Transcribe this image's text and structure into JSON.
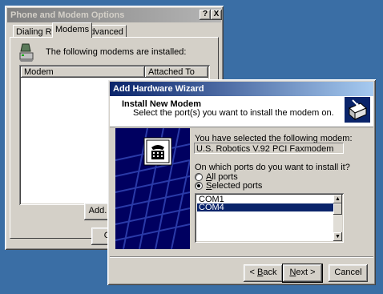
{
  "back_window": {
    "title": "Phone and Modem Options",
    "title_buttons": {
      "help": "?",
      "close": "X"
    },
    "tabs": [
      {
        "label": "Dialing Rules",
        "selected": false
      },
      {
        "label": "Modems",
        "selected": true
      },
      {
        "label": "Advanced",
        "selected": false
      }
    ],
    "installed_text": "The following modems are installed:",
    "columns": [
      "Modem",
      "Attached To"
    ],
    "add_button_partial": "Add...",
    "ok_button_partial": "O"
  },
  "wizard": {
    "title": "Add Hardware Wizard",
    "header_title": "Install New Modem",
    "header_subtitle": "Select the port(s) you want to install the modem on.",
    "selected_label": "You have selected the following modem:",
    "modem_name": "U.S. Robotics V.92 PCI Faxmodem",
    "question": "On which ports do you want to install it?",
    "radio_all_prefix": "A",
    "radio_all_rest": "ll ports",
    "radio_all_selected": false,
    "radio_selected_prefix": "S",
    "radio_selected_rest": "elected ports",
    "radio_selected_selected": true,
    "ports": [
      "COM1",
      "COM4"
    ],
    "selected_port": "COM4",
    "back_prefix": "< ",
    "back_key": "B",
    "back_rest": "ack",
    "next_key": "N",
    "next_rest": "ext >",
    "cancel_label": "Cancel"
  }
}
